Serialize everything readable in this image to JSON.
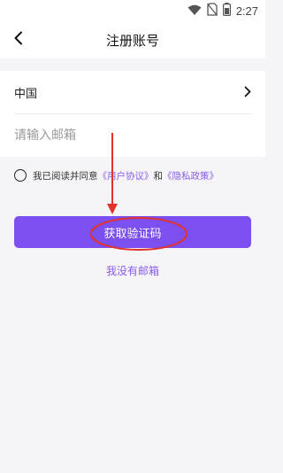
{
  "status_bar": {
    "time": "2:27",
    "icons": [
      "wifi-icon",
      "no-sim-icon",
      "battery-icon"
    ]
  },
  "header": {
    "title": "注册账号",
    "back_icon": "chevron-left-icon"
  },
  "form": {
    "country": "中国",
    "country_icon": "chevron-right-icon",
    "email_placeholder": "请输入邮箱",
    "email_value": ""
  },
  "agreement": {
    "prefix": "我已阅读并同意",
    "user_agreement": "《用户协议》",
    "conjunction": "和",
    "privacy_policy": "《隐私政策》",
    "checked": false
  },
  "primary_button": {
    "label": "获取验证码"
  },
  "secondary_link": {
    "label": "我没有邮箱"
  },
  "colors": {
    "accent": "#7b4ff0",
    "link": "#8a5cf0",
    "annotation": "#e0332b",
    "background": "#f5f5f7"
  },
  "annotations": [
    "red-arrow",
    "red-ellipse-highlight"
  ]
}
